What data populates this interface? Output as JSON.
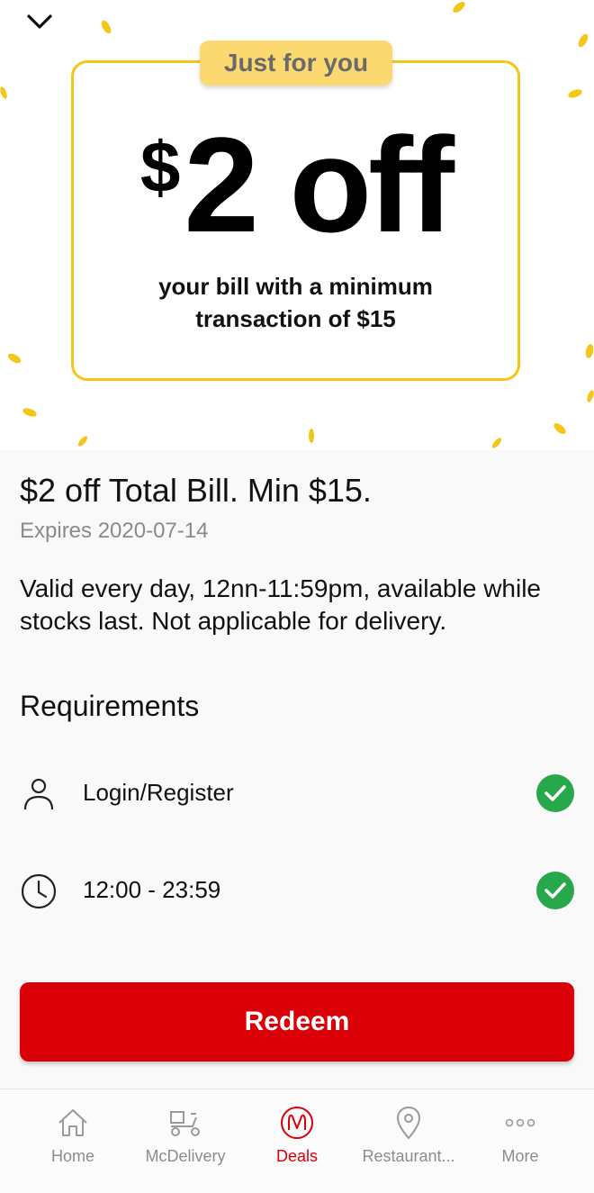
{
  "offer_card": {
    "badge": "Just for you",
    "currency_symbol": "$",
    "amount": "2 off",
    "subtitle_line1": "your bill with a minimum",
    "subtitle_line2": "transaction of $15"
  },
  "deal": {
    "title": "$2 off Total Bill. Min $15.",
    "expiry": "Expires 2020-07-14",
    "description": "Valid every day, 12nn-11:59pm, available while stocks last. Not applicable for delivery."
  },
  "requirements": {
    "heading": "Requirements",
    "items": [
      {
        "label": "Login/Register",
        "icon": "user-icon",
        "met": true
      },
      {
        "label": "12:00 - 23:59",
        "icon": "clock-icon",
        "met": true
      }
    ]
  },
  "redeem_label": "Redeem",
  "tabbar": {
    "items": [
      {
        "label": "Home",
        "icon": "home-icon",
        "active": false
      },
      {
        "label": "McDelivery",
        "icon": "delivery-scooter-icon",
        "active": false
      },
      {
        "label": "Deals",
        "icon": "deals-arches-icon",
        "active": true
      },
      {
        "label": "Restaurant...",
        "icon": "location-pin-icon",
        "active": false
      },
      {
        "label": "More",
        "icon": "more-dots-icon",
        "active": false
      }
    ]
  },
  "colors": {
    "accent_red": "#db0007",
    "card_yellow": "#f5c518",
    "badge_yellow": "#fbd970",
    "check_green": "#27a84a"
  }
}
